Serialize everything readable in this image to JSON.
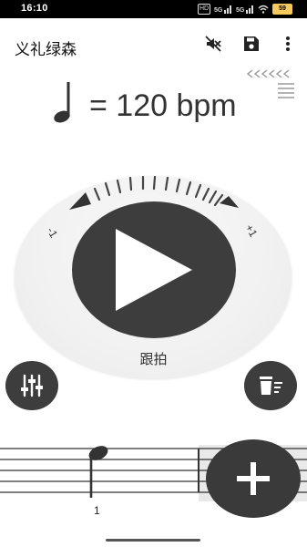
{
  "status_bar": {
    "time": "16:10",
    "network_badges": [
      "HD",
      "5G",
      "5G"
    ],
    "battery": "59"
  },
  "app_bar": {
    "title": "义礼绿森",
    "icons": [
      "mute-icon",
      "save-icon",
      "more-vert-icon"
    ]
  },
  "tempo": {
    "display": "= 120 bpm",
    "note_icon": "quarter-note-icon"
  },
  "dial": {
    "minus_label": "-1",
    "plus_label": "+1"
  },
  "play": {
    "icon": "play-icon"
  },
  "follow_label": "跟拍",
  "staff": {
    "beat_number": "1"
  },
  "colors": {
    "dark_button": "#3d3d3d",
    "background": "#ffffff",
    "dial": "#f1f1f1"
  }
}
